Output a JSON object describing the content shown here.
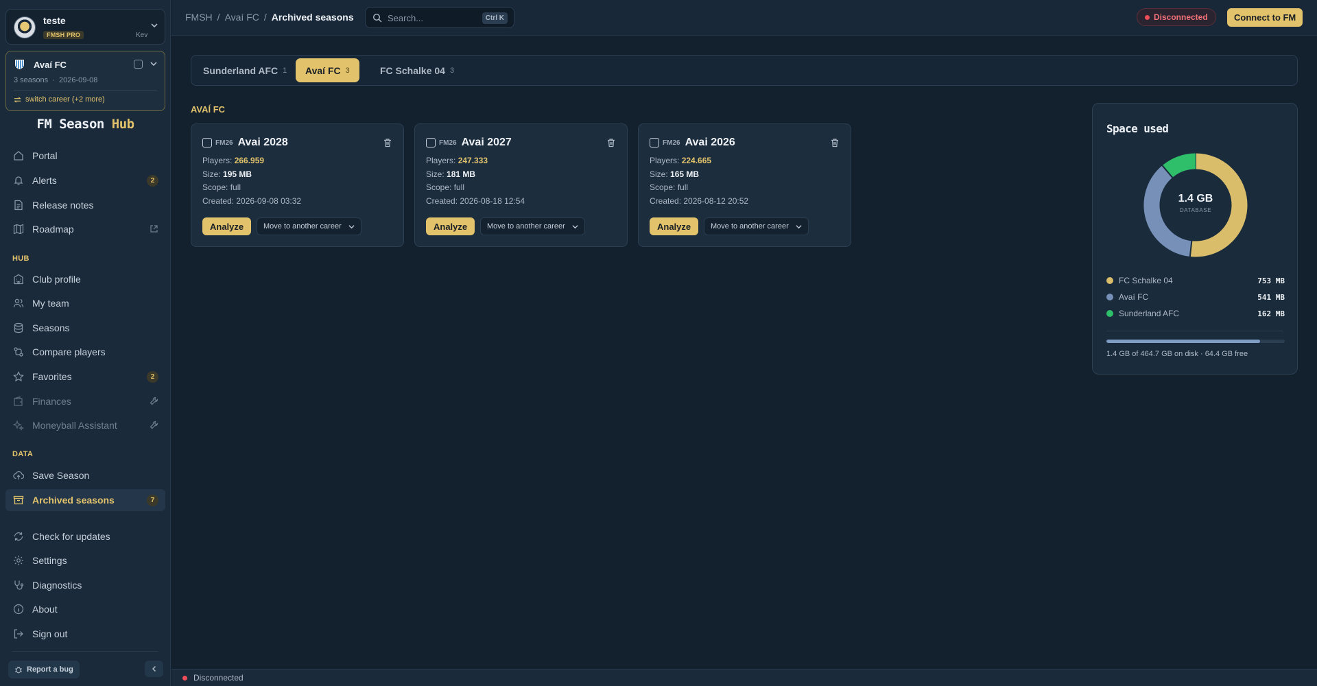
{
  "user": {
    "name": "teste",
    "badge": "FMSH PRO",
    "key": "Kev"
  },
  "career": {
    "name": "Avaí FC",
    "seasons": "3 seasons",
    "date": "2026-09-08",
    "switch": "switch career (+2 more)"
  },
  "brand": {
    "main": "FM Season ",
    "accent": "Hub"
  },
  "nav": {
    "portal": "Portal",
    "alerts": "Alerts",
    "alerts_count": "2",
    "release_notes": "Release notes",
    "roadmap": "Roadmap",
    "hub_label": "HUB",
    "club_profile": "Club profile",
    "my_team": "My team",
    "seasons": "Seasons",
    "compare_players": "Compare players",
    "favorites": "Favorites",
    "favorites_count": "2",
    "finances": "Finances",
    "moneyball": "Moneyball Assistant",
    "data_label": "DATA",
    "save_season": "Save Season",
    "archived_seasons": "Archived seasons",
    "archived_count": "7",
    "check_updates": "Check for updates",
    "settings": "Settings",
    "diagnostics": "Diagnostics",
    "about": "About",
    "sign_out": "Sign out"
  },
  "footer": {
    "report_bug": "Report a bug"
  },
  "breadcrumb": {
    "root": "FMSH",
    "club": "Avaí FC",
    "current": "Archived seasons",
    "sep": "/"
  },
  "search": {
    "placeholder": "Search...",
    "shortcut": "Ctrl K"
  },
  "status": {
    "connection": "Disconnected",
    "connect_button": "Connect to FM"
  },
  "tabs": [
    {
      "label": "Sunderland AFC",
      "count": "1"
    },
    {
      "label": "Avaí FC",
      "count": "3"
    },
    {
      "label": "FC Schalke 04",
      "count": "3"
    }
  ],
  "group_title": "AVAÍ FC",
  "card_labels": {
    "players": "Players: ",
    "size": "Size: ",
    "scope": "Scope: ",
    "created": "Created: ",
    "analyze": "Analyze",
    "move": "Move to another career",
    "fm_tag": "FM26"
  },
  "seasons": [
    {
      "title": "Avai 2028",
      "players": "266.959",
      "size": "195 MB",
      "scope": "full",
      "created": "2026-09-08 03:32"
    },
    {
      "title": "Avai 2027",
      "players": "247.333",
      "size": "181 MB",
      "scope": "full",
      "created": "2026-08-18 12:54"
    },
    {
      "title": "Avai 2026",
      "players": "224.665",
      "size": "165 MB",
      "scope": "full",
      "created": "2026-08-12 20:52"
    }
  ],
  "space": {
    "title": "Space used",
    "total": "1.4 GB",
    "total_label": "DATABASE",
    "items": [
      {
        "name": "FC Schalke 04",
        "value": "753 MB",
        "mb": 753,
        "color": "#d9bd6a"
      },
      {
        "name": "Avaí FC",
        "value": "541 MB",
        "mb": 541,
        "color": "#7790b8"
      },
      {
        "name": "Sunderland AFC",
        "value": "162 MB",
        "mb": 162,
        "color": "#2fbf6a"
      }
    ],
    "disk_fraction": 0.86,
    "disk_text": "1.4 GB of 464.7 GB on disk · 64.4 GB free"
  },
  "statusbar": {
    "text": "Disconnected"
  }
}
